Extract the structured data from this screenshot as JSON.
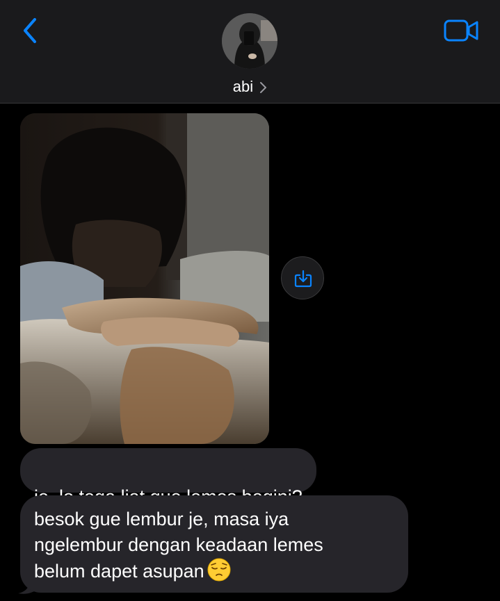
{
  "header": {
    "contact_name": "abi",
    "back_icon": "chevron-left-icon",
    "video_icon": "video-camera-icon",
    "accent_color": "#0a84ff",
    "avatar": "contact-avatar"
  },
  "messages": [
    {
      "type": "photo",
      "from": "contact",
      "save_icon": "save-download-icon"
    },
    {
      "type": "text",
      "from": "contact",
      "text": "je, lo tega liat gue lemes begini?"
    },
    {
      "type": "text",
      "from": "contact",
      "text": "besok gue lembur je, masa iya\nngelembur dengan keadaan lemes\nbelum dapet asupan",
      "emoji": "pensive-face-emoji"
    }
  ],
  "colors": {
    "background": "#000000",
    "header_bg": "#1a1a1c",
    "bubble_received": "#26252a",
    "text": "#ffffff"
  }
}
